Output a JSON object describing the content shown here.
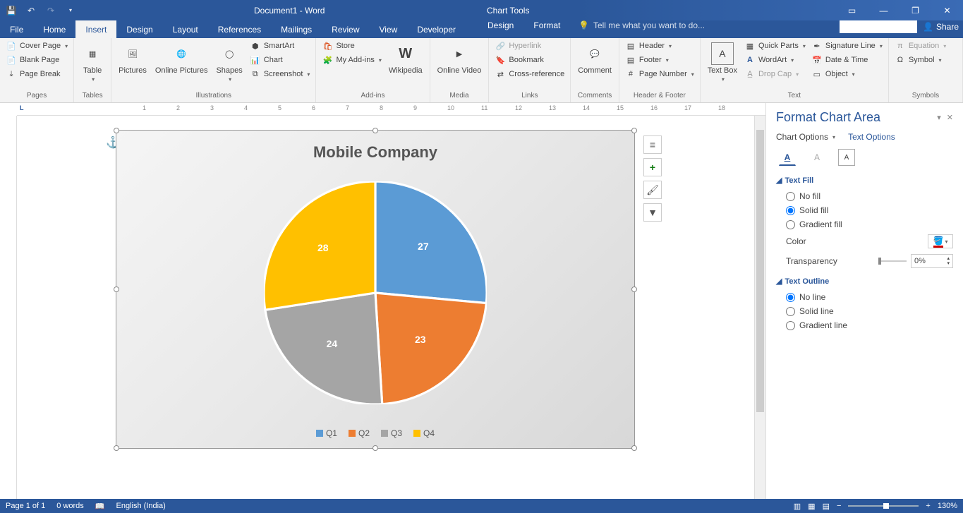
{
  "titlebar": {
    "doc_title": "Document1 - Word",
    "tool_title": "Chart Tools"
  },
  "tabs": {
    "file": "File",
    "main": [
      "Home",
      "Insert",
      "Design",
      "Layout",
      "References",
      "Mailings",
      "Review",
      "View",
      "Developer"
    ],
    "tool": [
      "Design",
      "Format"
    ],
    "active": "Insert",
    "tell_me": "Tell me what you want to do...",
    "share": "Share"
  },
  "ribbon": {
    "pages": {
      "label": "Pages",
      "cover": "Cover Page",
      "blank": "Blank Page",
      "break": "Page Break"
    },
    "tables": {
      "label": "Tables",
      "table": "Table"
    },
    "illustrations": {
      "label": "Illustrations",
      "pictures": "Pictures",
      "online_pictures": "Online Pictures",
      "shapes": "Shapes",
      "smartart": "SmartArt",
      "chart": "Chart",
      "screenshot": "Screenshot"
    },
    "addins": {
      "label": "Add-ins",
      "store": "Store",
      "my": "My Add-ins",
      "wikipedia": "Wikipedia"
    },
    "media": {
      "label": "Media",
      "video": "Online Video"
    },
    "links": {
      "label": "Links",
      "hyperlink": "Hyperlink",
      "bookmark": "Bookmark",
      "crossref": "Cross-reference"
    },
    "comments": {
      "label": "Comments",
      "comment": "Comment"
    },
    "headerfooter": {
      "label": "Header & Footer",
      "header": "Header",
      "footer": "Footer",
      "pagenum": "Page Number"
    },
    "text": {
      "label": "Text",
      "textbox": "Text Box",
      "quickparts": "Quick Parts",
      "wordart": "WordArt",
      "dropcap": "Drop Cap",
      "sigline": "Signature Line",
      "datetime": "Date & Time",
      "object": "Object"
    },
    "symbols": {
      "label": "Symbols",
      "equation": "Equation",
      "symbol": "Symbol"
    }
  },
  "chart_data": {
    "type": "pie",
    "title": "Mobile Company",
    "categories": [
      "Q1",
      "Q2",
      "Q3",
      "Q4"
    ],
    "values": [
      27,
      23,
      24,
      28
    ],
    "colors": [
      "#5b9bd5",
      "#ed7d31",
      "#a5a5a5",
      "#ffc000"
    ]
  },
  "format_pane": {
    "title": "Format Chart Area",
    "chart_options": "Chart Options",
    "text_options": "Text Options",
    "text_fill": {
      "head": "Text Fill",
      "no_fill": "No fill",
      "solid_fill": "Solid fill",
      "gradient_fill": "Gradient fill",
      "color": "Color",
      "transparency": "Transparency",
      "transparency_val": "0%"
    },
    "text_outline": {
      "head": "Text Outline",
      "no_line": "No line",
      "solid_line": "Solid line",
      "gradient_line": "Gradient line"
    }
  },
  "statusbar": {
    "page": "Page 1 of 1",
    "words": "0 words",
    "lang": "English (India)",
    "zoom": "130%"
  }
}
